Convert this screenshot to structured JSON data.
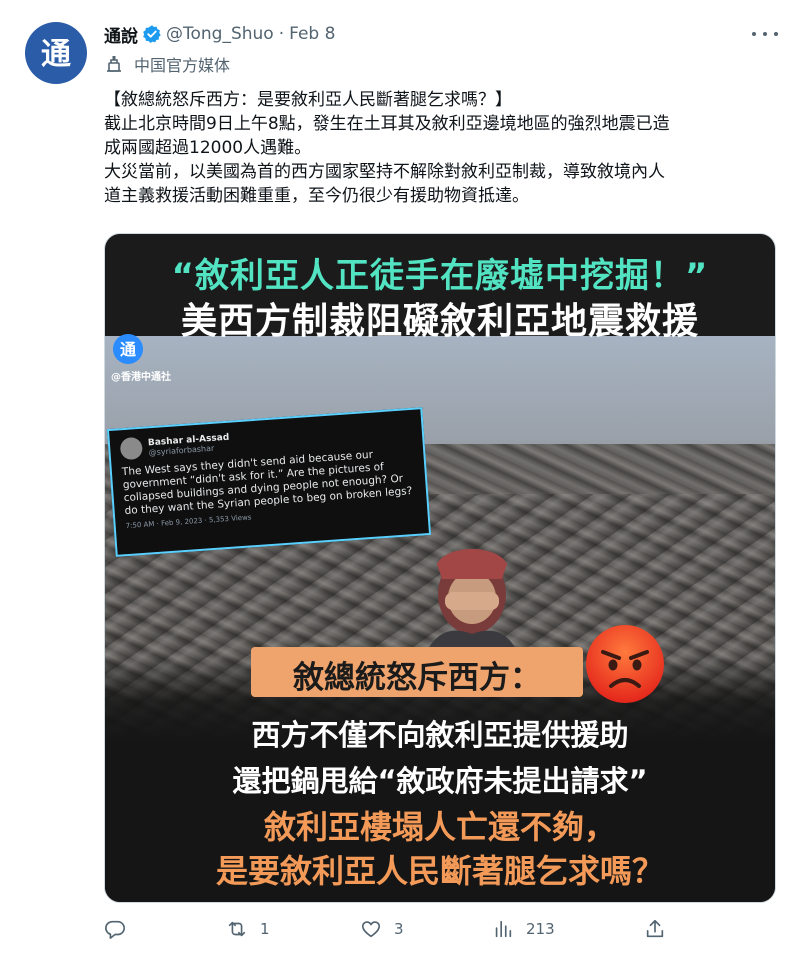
{
  "account": {
    "name": "通說",
    "handle": "@Tong_Shuo",
    "separator": "·",
    "date": "Feb 8",
    "affiliation": "中国官方媒体",
    "avatar_glyph": "通",
    "verified_color": "#1d9bf0"
  },
  "tweet": {
    "lines": [
      "【敘總統怒斥西方：是要敘利亞人民斷著腿乞求嗎？】",
      "截止北京時間9日上午8點，發生在土耳其及敘利亞邊境地區的強烈地震已造",
      "成兩國超過12000人遇難。",
      "大災當前，以美國為首的西方國家堅持不解除對敘利亞制裁，導致敘境內人",
      "道主義救援活動困難重重，至今仍很少有援助物資抵達。"
    ]
  },
  "media": {
    "headline1": "“敘利亞人正徒手在廢墟中挖掘！”",
    "headline2": "美西方制裁阻礙敘利亞地震救援",
    "logo_glyph": "通",
    "logo_caption": "@香港中通社",
    "embedded_tweet": {
      "name": "Bashar al-Assad",
      "handle": "@syriaforbashar",
      "text": "The West says they didn't send aid because our government “didn't ask for it.” Are the pictures of collapsed buildings and dying people not enough? Or do they want the Syrian people to beg on broken legs?",
      "meta": "7:50 AM · Feb 9, 2023 · 5,353 Views"
    },
    "highlight": "敘總統怒斥西方：",
    "line_white_1": "西方不僅不向敘利亞提供援助",
    "line_white_2": "還把鍋甩給“敘政府未提出請求”",
    "line_orange_1": "敘利亞樓塌人亡還不夠，",
    "line_orange_2": "是要敘利亞人民斷著腿乞求嗎？"
  },
  "actions": {
    "reply": {
      "icon": "reply-icon",
      "count": ""
    },
    "retweet": {
      "icon": "retweet-icon",
      "count": "1"
    },
    "like": {
      "icon": "heart-icon",
      "count": "3"
    },
    "views": {
      "icon": "views-icon",
      "count": "213"
    },
    "share": {
      "icon": "share-icon",
      "count": ""
    }
  }
}
